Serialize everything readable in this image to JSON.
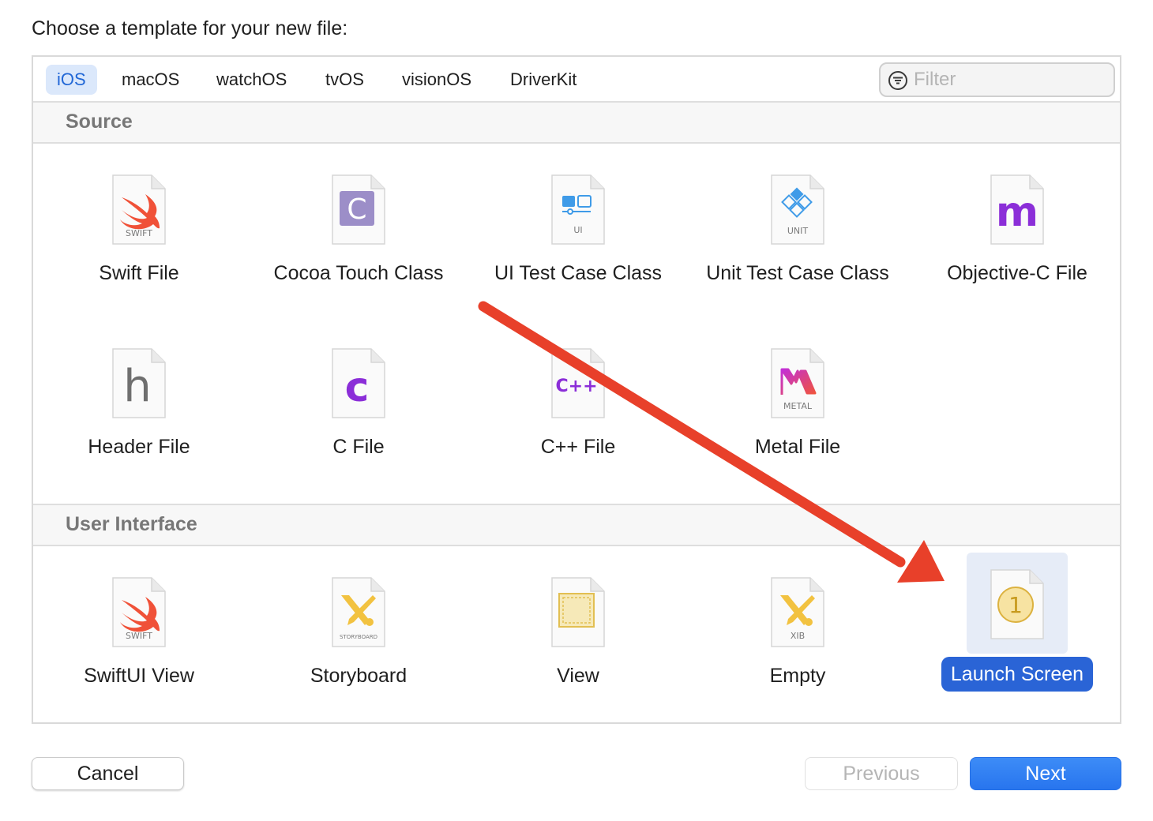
{
  "dialog": {
    "title": "Choose a template for your new file:"
  },
  "tabs": [
    {
      "label": "iOS",
      "active": true
    },
    {
      "label": "macOS",
      "active": false
    },
    {
      "label": "watchOS",
      "active": false
    },
    {
      "label": "tvOS",
      "active": false
    },
    {
      "label": "visionOS",
      "active": false
    },
    {
      "label": "DriverKit",
      "active": false
    }
  ],
  "filter": {
    "placeholder": "Filter",
    "value": "",
    "icon": "filter-icon"
  },
  "sections": [
    {
      "title": "Source",
      "templates": [
        {
          "label": "Swift File",
          "icon": "swift-icon",
          "badge": "SWIFT"
        },
        {
          "label": "Cocoa Touch Class",
          "icon": "cocoa-touch-class-icon",
          "badge": "C"
        },
        {
          "label": "UI Test Case Class",
          "icon": "ui-test-icon",
          "badge": "UI"
        },
        {
          "label": "Unit Test Case Class",
          "icon": "unit-test-icon",
          "badge": "UNIT"
        },
        {
          "label": "Objective-C File",
          "icon": "objective-c-icon",
          "badge": "m"
        },
        {
          "label": "Header File",
          "icon": "header-file-icon",
          "badge": "h"
        },
        {
          "label": "C File",
          "icon": "c-file-icon",
          "badge": "c"
        },
        {
          "label": "C++ File",
          "icon": "cpp-file-icon",
          "badge": "C++"
        },
        {
          "label": "Metal File",
          "icon": "metal-icon",
          "badge": "METAL"
        }
      ]
    },
    {
      "title": "User Interface",
      "templates": [
        {
          "label": "SwiftUI View",
          "icon": "swiftui-icon",
          "badge": "SWIFT"
        },
        {
          "label": "Storyboard",
          "icon": "storyboard-icon",
          "badge": "STORYBOARD"
        },
        {
          "label": "View",
          "icon": "view-xib-icon",
          "badge": ""
        },
        {
          "label": "Empty",
          "icon": "empty-xib-icon",
          "badge": "XIB"
        },
        {
          "label": "Launch Screen",
          "icon": "launch-screen-icon",
          "badge": "1",
          "selected": true
        }
      ]
    }
  ],
  "buttons": {
    "cancel": "Cancel",
    "previous": "Previous",
    "next": "Next"
  },
  "colors": {
    "accent": "#2a64d6",
    "annotation_arrow": "#e8402a",
    "tab_active_bg": "#dbe8fb"
  }
}
